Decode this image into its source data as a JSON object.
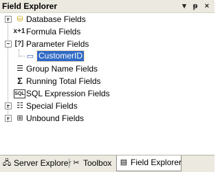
{
  "window": {
    "title": "Field Explorer",
    "buttons": {
      "dropdown": "▾",
      "pin": "ᵽ",
      "close": "×"
    }
  },
  "tree": {
    "items": [
      {
        "label": "Database Fields",
        "icon": "database-icon",
        "glyph": "⛁",
        "expanded": false
      },
      {
        "label": "Formula Fields",
        "icon": "formula-icon",
        "glyph": "x+1",
        "expanded": null
      },
      {
        "label": "Parameter Fields",
        "icon": "parameter-icon",
        "glyph": "[?]",
        "expanded": true
      },
      {
        "label": "CustomerID",
        "icon": "parameter-field-icon",
        "glyph": "▭",
        "selected": true,
        "child": true
      },
      {
        "label": "Group Name Fields",
        "icon": "group-name-icon",
        "glyph": "☰",
        "expanded": null
      },
      {
        "label": "Running Total Fields",
        "icon": "running-total-icon",
        "glyph": "Σ",
        "expanded": null
      },
      {
        "label": "SQL Expression Fields",
        "icon": "sql-expression-icon",
        "glyph": "SQL",
        "expanded": null
      },
      {
        "label": "Special Fields",
        "icon": "special-fields-icon",
        "glyph": "☷",
        "expanded": false
      },
      {
        "label": "Unbound Fields",
        "icon": "unbound-fields-icon",
        "glyph": "⊞",
        "expanded": false
      }
    ]
  },
  "tabs": [
    {
      "label": "Server Explorer",
      "icon": "server-explorer-icon",
      "glyph": "🖧"
    },
    {
      "label": "Toolbox",
      "icon": "toolbox-icon",
      "glyph": "✂"
    },
    {
      "label": "Field Explorer",
      "icon": "field-explorer-icon",
      "glyph": "▤",
      "active": true
    }
  ],
  "colors": {
    "selection": "#316ac5",
    "chrome": "#ebe9e0"
  }
}
